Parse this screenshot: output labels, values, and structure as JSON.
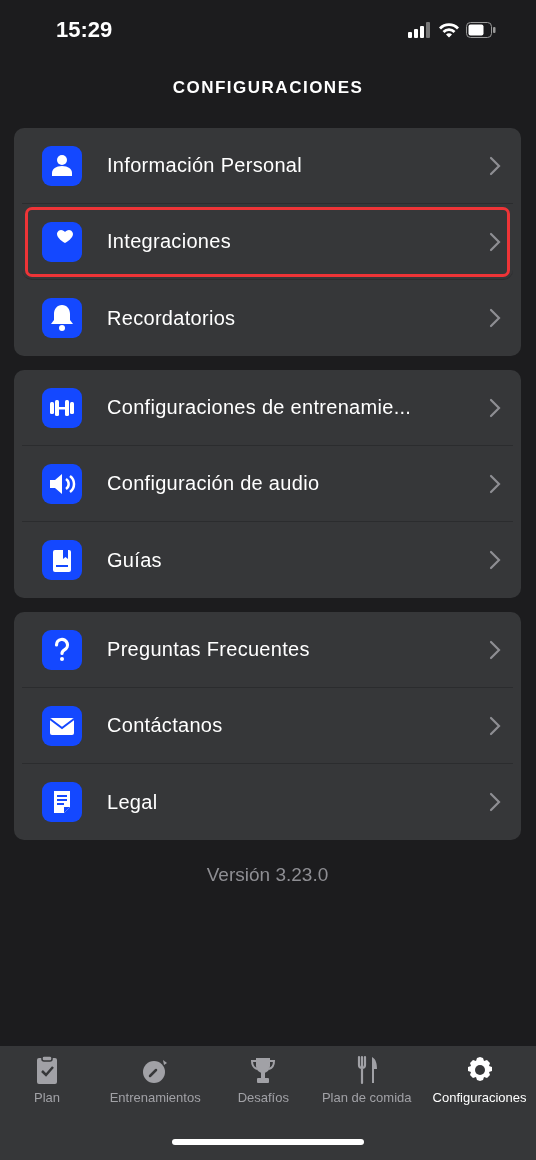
{
  "status_bar": {
    "time": "15:29"
  },
  "title": "CONFIGURACIONES",
  "groups": [
    {
      "items": [
        {
          "label": "Información Personal",
          "highlighted": false
        },
        {
          "label": "Integraciones",
          "highlighted": true
        },
        {
          "label": "Recordatorios",
          "highlighted": false
        }
      ]
    },
    {
      "items": [
        {
          "label": "Configuraciones de entrenamie...",
          "highlighted": false
        },
        {
          "label": "Configuración de audio",
          "highlighted": false
        },
        {
          "label": "Guías",
          "highlighted": false
        }
      ]
    },
    {
      "items": [
        {
          "label": "Preguntas Frecuentes",
          "highlighted": false
        },
        {
          "label": "Contáctanos",
          "highlighted": false
        },
        {
          "label": "Legal",
          "highlighted": false
        }
      ]
    }
  ],
  "version": "Versión 3.23.0",
  "tabs": [
    {
      "label": "Plan",
      "selected": false
    },
    {
      "label": "Entrenamientos",
      "selected": false
    },
    {
      "label": "Desafíos",
      "selected": false
    },
    {
      "label": "Plan de comida",
      "selected": false
    },
    {
      "label": "Configuraciones",
      "selected": true
    }
  ]
}
